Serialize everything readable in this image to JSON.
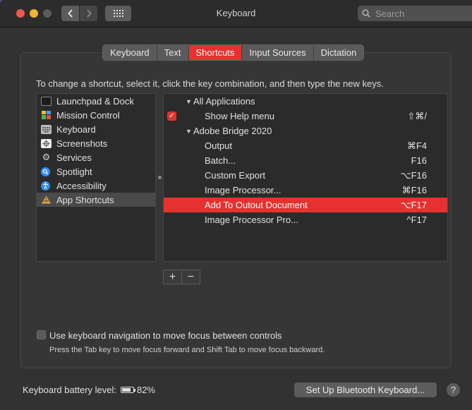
{
  "window": {
    "title": "Keyboard"
  },
  "search": {
    "placeholder": "Search"
  },
  "tabs": [
    {
      "label": "Keyboard"
    },
    {
      "label": "Text"
    },
    {
      "label": "Shortcuts"
    },
    {
      "label": "Input Sources"
    },
    {
      "label": "Dictation"
    }
  ],
  "active_tab": "Shortcuts",
  "instruction": "To change a shortcut, select it, click the key combination, and then type the new keys.",
  "categories": [
    {
      "label": "Launchpad & Dock",
      "icon": "launchpad-icon"
    },
    {
      "label": "Mission Control",
      "icon": "mission-control-icon"
    },
    {
      "label": "Keyboard",
      "icon": "keyboard-icon"
    },
    {
      "label": "Screenshots",
      "icon": "screenshots-icon"
    },
    {
      "label": "Services",
      "icon": "gear-icon"
    },
    {
      "label": "Spotlight",
      "icon": "spotlight-icon"
    },
    {
      "label": "Accessibility",
      "icon": "accessibility-icon"
    },
    {
      "label": "App Shortcuts",
      "icon": "app-shortcuts-icon"
    }
  ],
  "selected_category": "App Shortcuts",
  "shortcuts": {
    "group1": {
      "label": "All Applications"
    },
    "group1_items": [
      {
        "name": "Show Help menu",
        "keys": "⇧⌘/",
        "checked": true
      }
    ],
    "group2": {
      "label": "Adobe Bridge 2020"
    },
    "group2_items": [
      {
        "name": "Output",
        "keys": "⌘F4"
      },
      {
        "name": "Batch...",
        "keys": "F16"
      },
      {
        "name": "Custom Export",
        "keys": "⌥F16"
      },
      {
        "name": "Image Processor...",
        "keys": "⌘F16"
      },
      {
        "name": "Add To Outout Document",
        "keys": "⌥F17",
        "selected": true
      },
      {
        "name": "Image Processor Pro...",
        "keys": "^F17"
      }
    ]
  },
  "buttons": {
    "add": "+",
    "remove": "−"
  },
  "nav_option": {
    "label": "Use keyboard navigation to move focus between controls",
    "hint": "Press the Tab key to move focus forward and Shift Tab to move focus backward."
  },
  "battery": {
    "label": "Keyboard battery level:",
    "value": "82%",
    "percent": 82
  },
  "bluetooth_button": "Set Up Bluetooth Keyboard...",
  "help_label": "?",
  "colors": {
    "accent": "#e5322e",
    "background": "#323232"
  }
}
